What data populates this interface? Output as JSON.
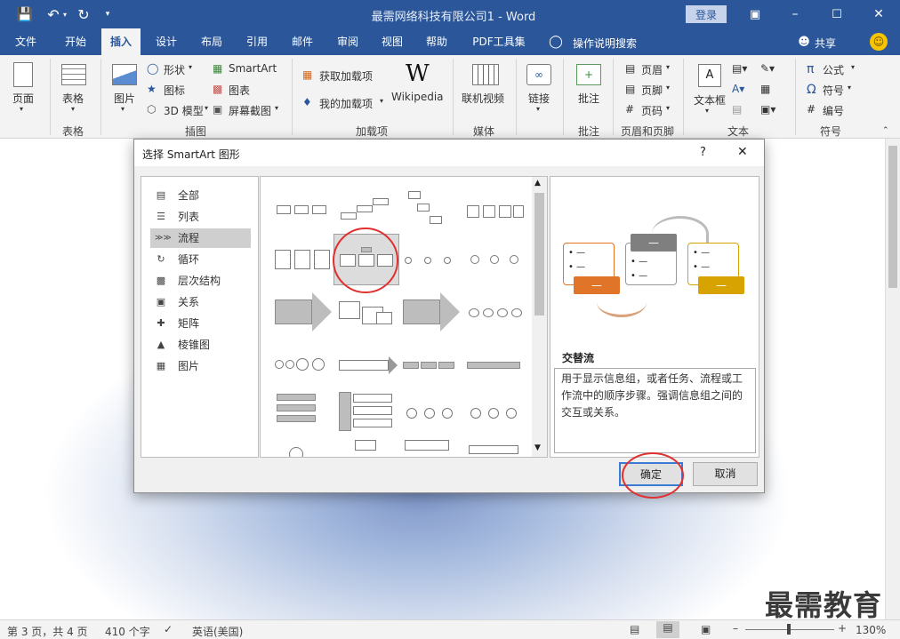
{
  "window": {
    "title": "最需网络科技有限公司1 - Word",
    "login_label": "登录"
  },
  "tabs": [
    "文件",
    "开始",
    "插入",
    "设计",
    "布局",
    "引用",
    "邮件",
    "审阅",
    "视图",
    "帮助",
    "PDF工具集"
  ],
  "tell_me": "操作说明搜索",
  "share_label": "共享",
  "ribbon": {
    "page_btn": "页面",
    "table_btn": "表格",
    "picture_btn": "图片",
    "shapes": "形状",
    "icons": "图标",
    "model3d": "3D 模型",
    "smartart": "SmartArt",
    "chart": "图表",
    "screenshot": "屏幕截图",
    "get_addins": "获取加载项",
    "my_addins": "我的加载项",
    "wikipedia": "Wikipedia",
    "online_video": "联机视频",
    "link": "链接",
    "comment": "批注",
    "header": "页眉",
    "footer": "页脚",
    "page_number": "页码",
    "textbox": "文本框",
    "equation": "公式",
    "symbol": "符号",
    "numbering": "编号",
    "groups": {
      "tables": "表格",
      "illustrations": "插图",
      "addins": "加载项",
      "media": "媒体",
      "comments": "批注",
      "header_footer": "页眉和页脚",
      "text": "文本",
      "symbols": "符号"
    }
  },
  "dialog": {
    "title": "选择 SmartArt 图形",
    "help": "?",
    "close": "✕",
    "categories": [
      {
        "label": "全部",
        "icon": "all-icon"
      },
      {
        "label": "列表",
        "icon": "list-icon"
      },
      {
        "label": "流程",
        "icon": "process-icon"
      },
      {
        "label": "循环",
        "icon": "cycle-icon"
      },
      {
        "label": "层次结构",
        "icon": "hierarchy-icon"
      },
      {
        "label": "关系",
        "icon": "relationship-icon"
      },
      {
        "label": "矩阵",
        "icon": "matrix-icon"
      },
      {
        "label": "棱锥图",
        "icon": "pyramid-icon"
      },
      {
        "label": "图片",
        "icon": "picture-icon"
      }
    ],
    "selected_category": "流程",
    "preview_name": "交替流",
    "preview_desc": "用于显示信息组，或者任务、流程或工作流中的顺序步骤。强调信息组之间的交互或关系。",
    "preview_bullet": "• —",
    "preview_dash": "—",
    "ok_label": "确定",
    "cancel_label": "取消"
  },
  "status": {
    "page": "第 3 页，共 4 页",
    "words": "410 个字",
    "language": "英语(美国)",
    "zoom": "130%"
  },
  "watermark": "最需教育",
  "colors": {
    "word_blue": "#2b579a",
    "orange": "#e07428",
    "gray": "#7f7f7f",
    "gold": "#d6a300"
  }
}
